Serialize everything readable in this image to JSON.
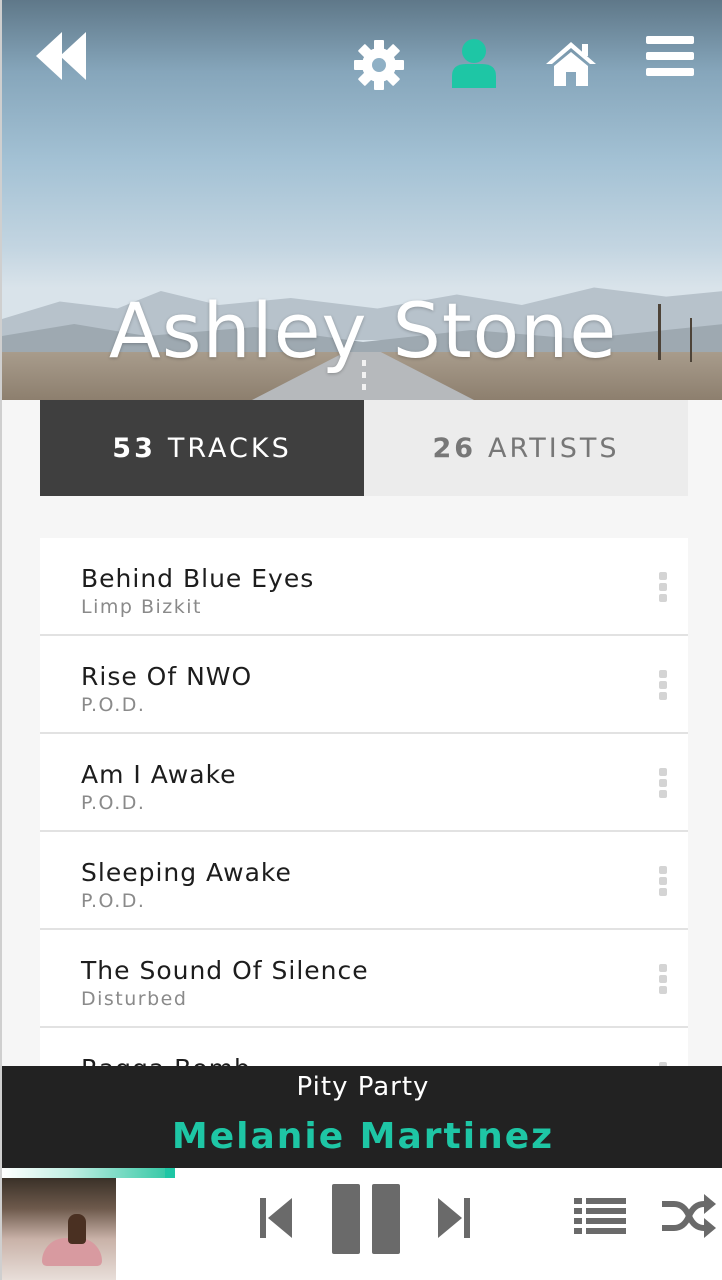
{
  "header": {
    "profile_name": "Ashley Stone",
    "icons": [
      "back-double-arrow-icon",
      "gear-icon",
      "user-icon",
      "home-icon",
      "hamburger-menu-icon"
    ],
    "active_icon_color": "#1ec6a5"
  },
  "tabs": [
    {
      "count": "53",
      "label": "TRACKS",
      "active": true
    },
    {
      "count": "26",
      "label": "ARTISTS",
      "active": false
    }
  ],
  "tracks": [
    {
      "title": "Behind Blue Eyes",
      "artist": "Limp Bizkit"
    },
    {
      "title": "Rise Of NWO",
      "artist": "P.O.D."
    },
    {
      "title": "Am I Awake",
      "artist": "P.O.D."
    },
    {
      "title": "Sleeping Awake",
      "artist": "P.O.D."
    },
    {
      "title": "The Sound Of Silence",
      "artist": "Disturbed"
    },
    {
      "title": "Ragga Bomb",
      "artist": ""
    }
  ],
  "now_playing": {
    "song": "Pity Party",
    "artist": "Melanie Martinez",
    "progress": 0.24
  },
  "controls": {
    "icons": [
      "skip-previous-icon",
      "pause-icon",
      "skip-next-icon",
      "queue-list-icon",
      "shuffle-icon"
    ],
    "color": "#6a6a6a"
  },
  "colors": {
    "accent": "#1ec6a5",
    "tab_active_bg": "#3f3f3f",
    "tab_inactive_bg": "#ececec",
    "now_playing_bg": "#222222"
  }
}
